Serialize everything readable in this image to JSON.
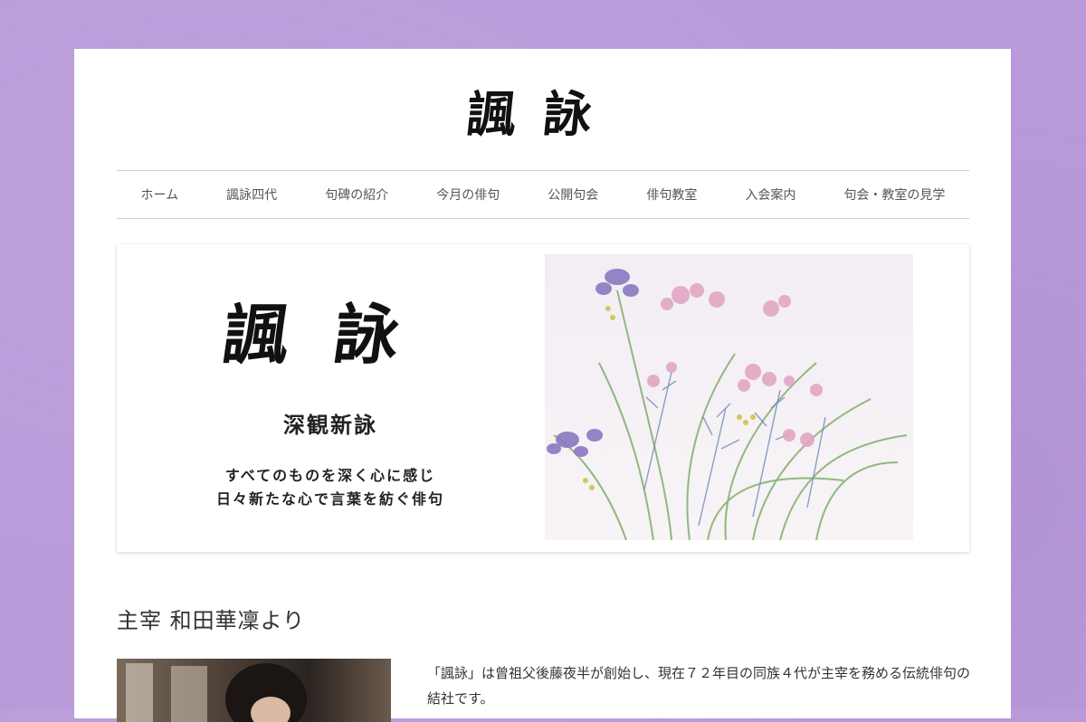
{
  "site": {
    "logo_text": "諷詠"
  },
  "nav": {
    "items": [
      {
        "label": "ホーム"
      },
      {
        "label": "諷詠四代"
      },
      {
        "label": "句碑の紹介"
      },
      {
        "label": "今月の俳句"
      },
      {
        "label": "公開句会"
      },
      {
        "label": "俳句教室"
      },
      {
        "label": "入会案内"
      },
      {
        "label": "句会・教室の見学"
      }
    ]
  },
  "hero": {
    "calligraphy": "諷詠",
    "motto": "深観新詠",
    "line1": "すべてのものを深く心に感じ",
    "line2": "日々新たな心で言葉を紡ぐ俳句"
  },
  "section": {
    "title": "主宰 和田華凜より"
  },
  "intro": {
    "text": "「諷詠」は曾祖父後藤夜半が創始し、現在７２年目の同族４代が主宰を務める伝統俳句の結社です。"
  }
}
